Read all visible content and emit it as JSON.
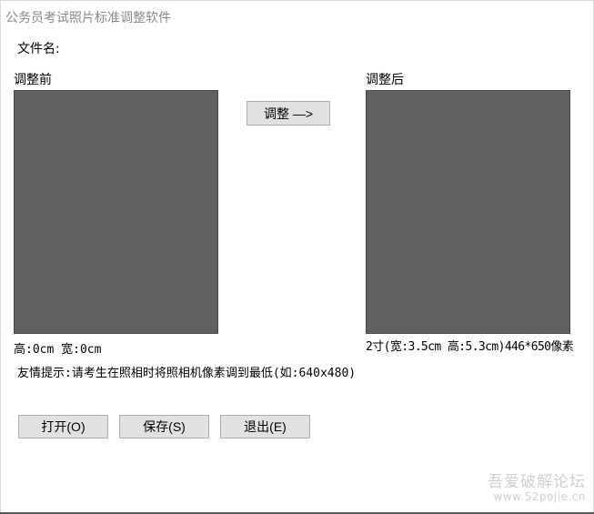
{
  "window": {
    "title": "公务员考试照片标准调整软件"
  },
  "file": {
    "label": "文件名:"
  },
  "before": {
    "label": "调整前",
    "size_text": "高:0cm  宽:0cm"
  },
  "after": {
    "label": "调整后",
    "size_text": "2寸(宽:3.5cm 高:5.3cm)446*650像素"
  },
  "adjust_button": {
    "label": "调整 —>"
  },
  "tip": {
    "text": "友情提示:请考生在照相时将照相机像素调到最低(如:640x480)"
  },
  "buttons": {
    "open": "打开(O)",
    "save": "保存(S)",
    "exit": "退出(E)"
  },
  "watermark": {
    "line1": "吾爱破解论坛",
    "line2": "www.52pojie.cn"
  },
  "colors": {
    "photo_placeholder": "#606060",
    "button_bg": "#e1e1e1",
    "title_text": "#8a8a8a"
  }
}
